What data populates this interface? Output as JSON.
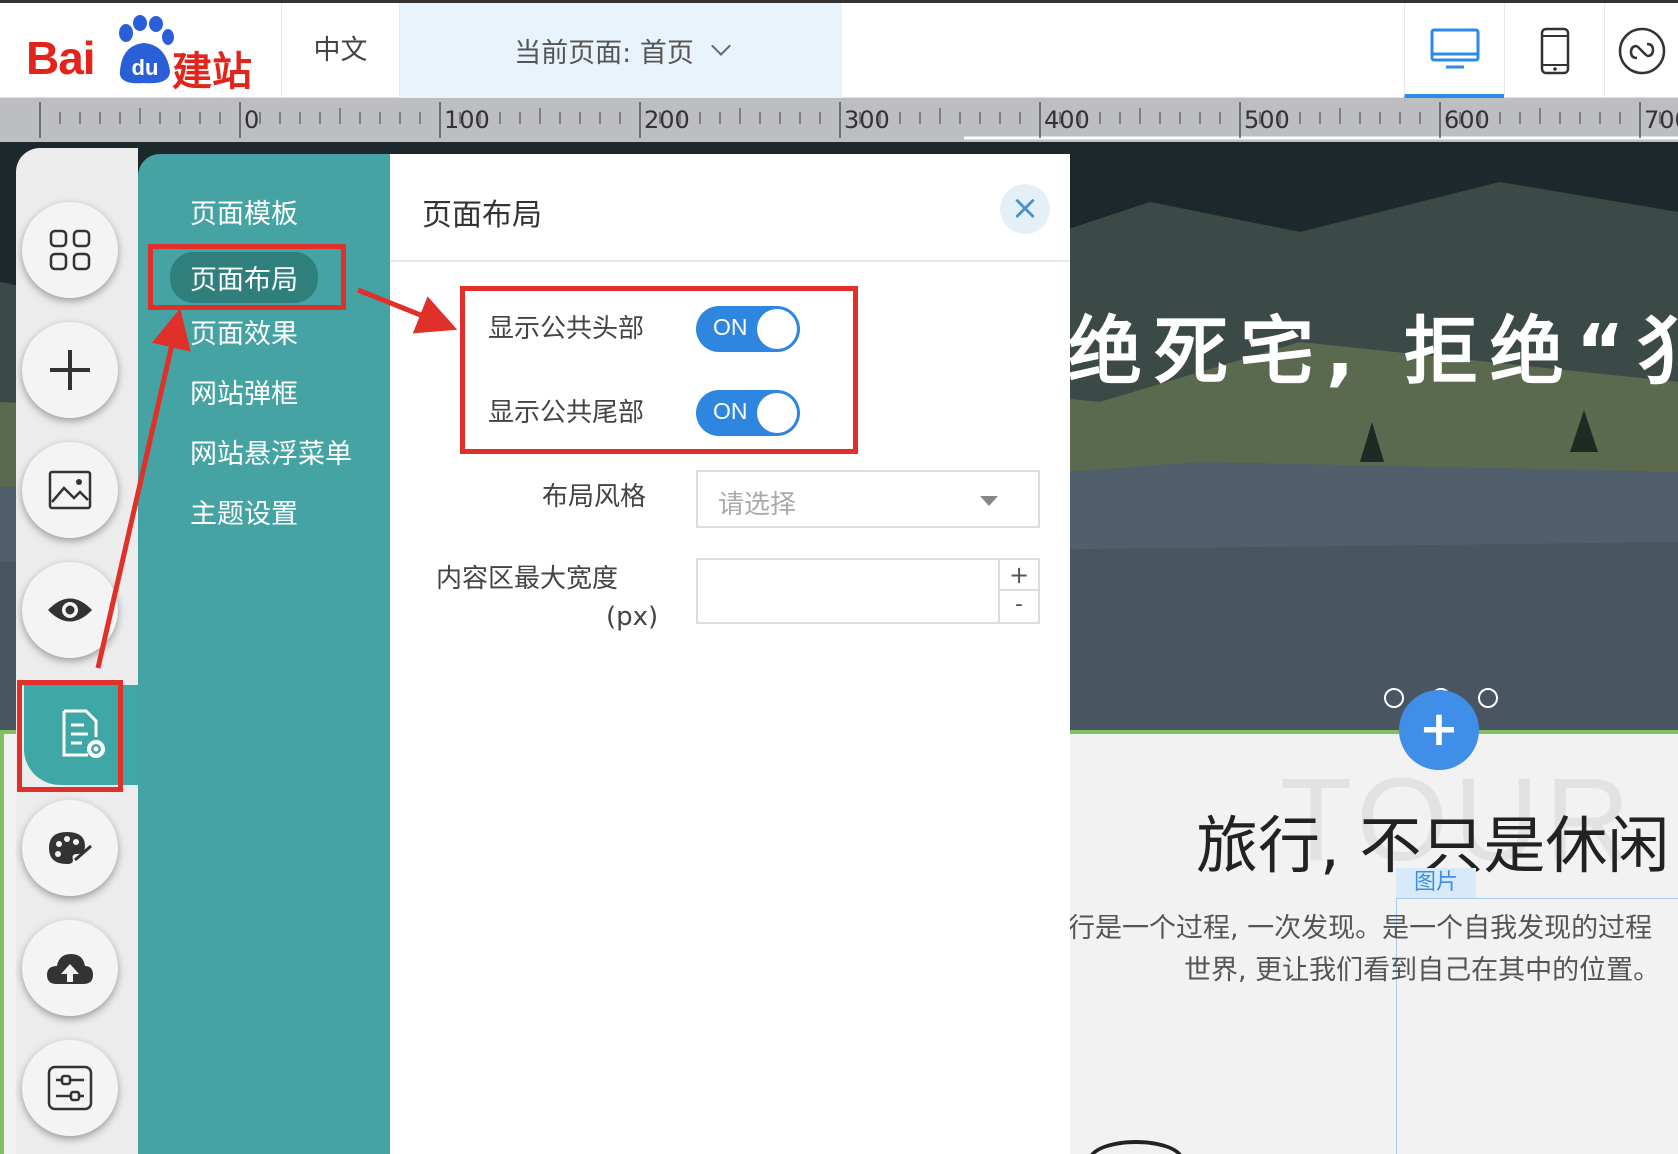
{
  "colors": {
    "brand_red": "#e1251b",
    "accent_blue": "#2e86e0",
    "teal_menu": "#45a3a3",
    "annotation_red": "#e0302a"
  },
  "header": {
    "logo": {
      "text_a": "Bai",
      "text_b": "du",
      "text_c": "建站"
    },
    "language": "中文",
    "current_page": "当前页面: 首页",
    "device_buttons": [
      "desktop-icon",
      "mobile-icon",
      "link-icon"
    ]
  },
  "ruler": {
    "labels": [
      "0",
      "100",
      "200",
      "300",
      "400",
      "500",
      "600",
      "700"
    ]
  },
  "toolbar": {
    "tools": [
      "apps-icon",
      "add-icon",
      "image-icon",
      "preview-eye-icon",
      "page-settings-icon",
      "palette-icon",
      "cloud-upload-icon",
      "sliders-icon"
    ]
  },
  "settings_menu": {
    "items": [
      "页面模板",
      "页面布局",
      "页面效果",
      "网站弹框",
      "网站悬浮菜单",
      "主题设置"
    ],
    "active_index": 1
  },
  "layout_panel": {
    "title": "页面布局",
    "close_icon": "close-icon",
    "show_header": {
      "label": "显示公共头部",
      "state": "ON"
    },
    "show_footer": {
      "label": "显示公共尾部",
      "state": "ON"
    },
    "layout_style": {
      "label": "布局风格",
      "placeholder": "请选择"
    },
    "max_width": {
      "label_line1": "内容区最大宽度",
      "label_line2": "(px)",
      "value": "",
      "plus": "+",
      "minus": "-"
    }
  },
  "preview": {
    "hero_text": "绝死宅, 拒绝“犭",
    "add_label": "+",
    "tour_bg": "TOUR",
    "section_title": "旅行, 不只是休闲",
    "image_tag": "图片",
    "desc_line1": "行是一个过程, 一次发现。是一个自我发现的过程",
    "desc_line2": "世界, 更让我们看到自己在其中的位置。"
  }
}
